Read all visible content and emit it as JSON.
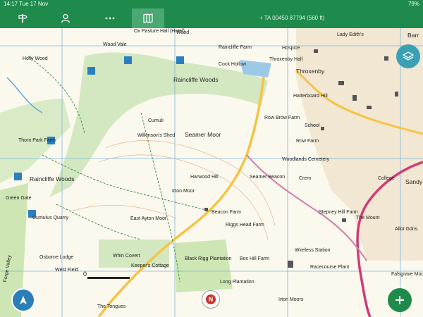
{
  "status_bar": {
    "time_date": "14:17  Tue 17 Nov",
    "battery": "79%"
  },
  "toolbar": {
    "buttons": [
      {
        "name": "routes-button",
        "icon": "signpost-icon"
      },
      {
        "name": "account-button",
        "icon": "person-icon"
      },
      {
        "name": "more-button",
        "icon": "ellipsis-icon"
      },
      {
        "name": "map-button",
        "icon": "map-icon",
        "active": true
      }
    ],
    "grid_reference": "+ TA 00450 87794  (560 ft)"
  },
  "map": {
    "scale_label": "0",
    "compass_label": "N",
    "place_labels": [
      {
        "text": "Ox Pasture Hall (Hotel)"
      },
      {
        "text": "Wood"
      },
      {
        "text": "Raincliffe Farm"
      },
      {
        "text": "Lady Edith's"
      },
      {
        "text": "Barr"
      },
      {
        "text": "Holly Wood"
      },
      {
        "text": "Wood Vale"
      },
      {
        "text": "Cock Hollow"
      },
      {
        "text": "Hospice"
      },
      {
        "text": "Throxenby Hall"
      },
      {
        "text": "Throxenby"
      },
      {
        "text": "Raincliffe Woods"
      },
      {
        "text": "Hatterboard Hill"
      },
      {
        "text": "Row Brow Farm"
      },
      {
        "text": "Thorn Park Farm"
      },
      {
        "text": "Wilkinson's Shed"
      },
      {
        "text": "Seamer Moor"
      },
      {
        "text": "Row Farm"
      },
      {
        "text": "Woodlands Cemetery"
      },
      {
        "text": "Raincliffe Woods"
      },
      {
        "text": "Harwood Hill"
      },
      {
        "text": "Seamer Beacon"
      },
      {
        "text": "Irton Moor"
      },
      {
        "text": "Beacon Farm"
      },
      {
        "text": "Stepney Hill Farm"
      },
      {
        "text": "Cumulus Quarry"
      },
      {
        "text": "East Ayton Moor"
      },
      {
        "text": "Riggs Head Farm"
      },
      {
        "text": "Osborne Lodge"
      },
      {
        "text": "Whin Covert"
      },
      {
        "text": "Keeper's Cottage"
      },
      {
        "text": "Black Rigg Plantation"
      },
      {
        "text": "Box Hill Farm"
      },
      {
        "text": "Wireless Station"
      },
      {
        "text": "Racecourse Plant"
      },
      {
        "text": "West Field"
      },
      {
        "text": "Long Plantation"
      },
      {
        "text": "Irton Moors"
      },
      {
        "text": "Falsgrave Moor"
      },
      {
        "text": "Allot Gdns"
      },
      {
        "text": "The Tongues"
      },
      {
        "text": "The Mount"
      },
      {
        "text": "Forge Valley"
      },
      {
        "text": "Green Gate"
      },
      {
        "text": "College"
      },
      {
        "text": "Sandy"
      },
      {
        "text": "Crem"
      },
      {
        "text": "School"
      },
      {
        "text": "Cumuli"
      }
    ]
  },
  "colors": {
    "brand_green": "#1e8a4c",
    "road_pink": "#d23a78",
    "woodland_green": "#cfe6b8",
    "layers_fab": "#3aa0b3",
    "locate_fab": "#2a7fb8"
  }
}
